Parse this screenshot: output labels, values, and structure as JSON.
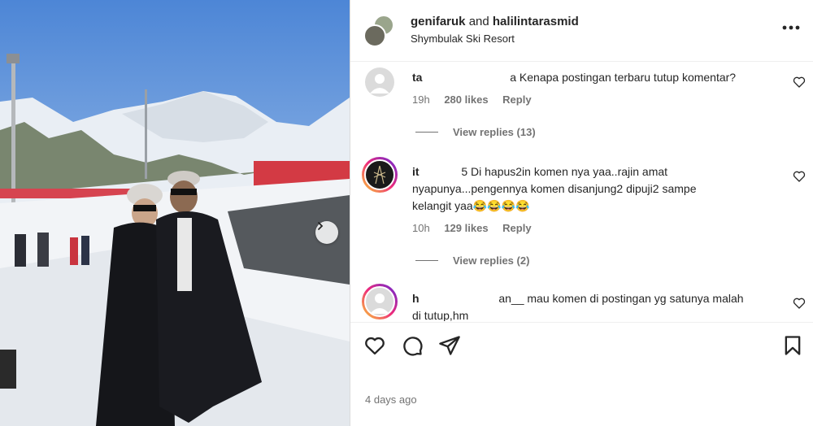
{
  "header": {
    "user1": "genifaruk",
    "and": "and",
    "user2": "halilintarasmid",
    "location": "Shymbulak Ski Resort",
    "more_icon": "more-horizontal-icon"
  },
  "comments": [
    {
      "user": "ta",
      "text": "a Kenapa postingan terbaru tutup komentar?",
      "time": "19h",
      "likes": "280 likes",
      "reply": "Reply",
      "view_replies": "View replies (13)"
    },
    {
      "user": "it",
      "text_line1": "5 Di hapus2in komen nya yaa..rajin amat",
      "text_line2": "nyapunya...pengennya komen disanjung2 dipuji2 sampe",
      "text_line3": "kelangit yaa😂😂😂😂",
      "time": "10h",
      "likes": "129 likes",
      "reply": "Reply",
      "view_replies": "View replies (2)"
    },
    {
      "user": "h",
      "text_line1": "an__ mau komen di postingan yg satunya malah",
      "text_line2": "di tutup,hm"
    }
  ],
  "footer": {
    "date": "4 days ago"
  },
  "colors": {
    "text": "#262626",
    "muted": "#737373",
    "border": "#dbdbdb"
  }
}
